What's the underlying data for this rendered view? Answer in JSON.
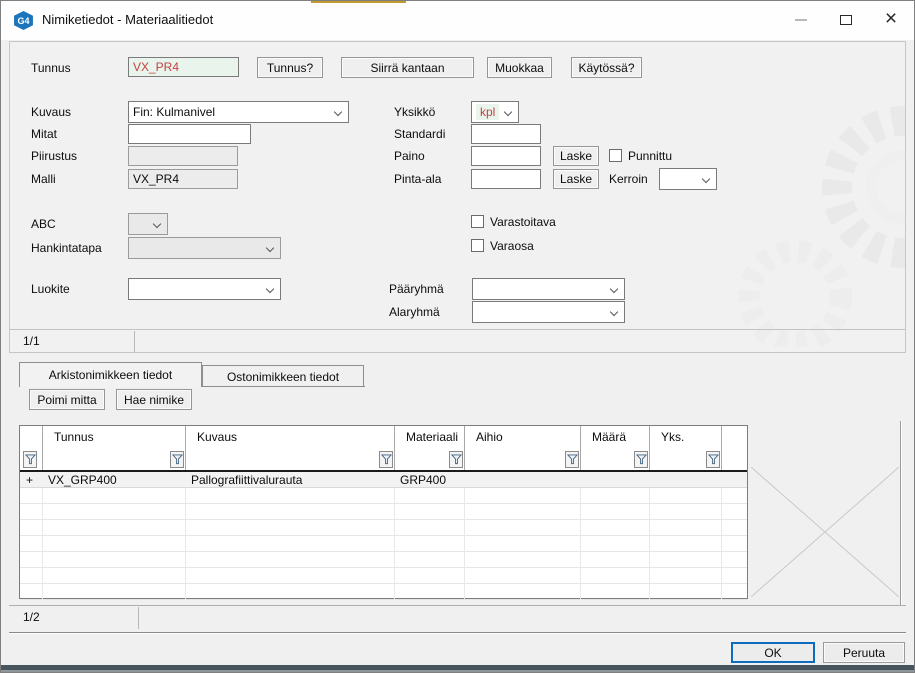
{
  "window": {
    "title": "Nimiketiedot - Materiaalitiedot",
    "icon_text": "G4"
  },
  "top_form": {
    "tunnus_label": "Tunnus",
    "tunnus_value": "VX_PR4",
    "btn_tunnus": "Tunnus?",
    "btn_siirra_kantaan": "Siirrä kantaan",
    "btn_muokkaa": "Muokkaa",
    "btn_kaytossa": "Käytössä?",
    "kuvaus_label": "Kuvaus",
    "kuvaus_value": "Fin: Kulmanivel",
    "yksikko_label": "Yksikkö",
    "yksikko_value": "kpl",
    "mitat_label": "Mitat",
    "mitat_value": "",
    "standardi_label": "Standardi",
    "standardi_value": "",
    "piirustus_label": "Piirustus",
    "piirustus_value": "",
    "paino_label": "Paino",
    "paino_value": "",
    "btn_laske": "Laske",
    "punnittu_label": "Punnittu",
    "malli_label": "Malli",
    "malli_value": "VX_PR4",
    "pinta_ala_label": "Pinta-ala",
    "pinta_ala_value": "",
    "kerroin_label": "Kerroin",
    "abc_label": "ABC",
    "hankintatapa_label": "Hankintatapa",
    "varastoitava_label": "Varastoitava",
    "varaosa_label": "Varaosa",
    "luokite_label": "Luokite",
    "paaryhma_label": "Pääryhmä",
    "alaryhma_label": "Alaryhmä",
    "pager": "1/1"
  },
  "tabs": [
    {
      "label": "Arkistonimikkeen tiedot",
      "active": true
    },
    {
      "label": "Ostonimikkeen tiedot",
      "active": false
    }
  ],
  "archive_tab": {
    "btn_poimi_mitta": "Poimi mitta",
    "btn_hae_nimike": "Hae nimike",
    "pager": "1/2"
  },
  "table": {
    "columns": [
      "Tunnus",
      "Kuvaus",
      "Materiaali",
      "Aihio",
      "Määrä",
      "Yks."
    ],
    "rows": [
      {
        "expand": "+",
        "tunnus": "VX_GRP400",
        "kuvaus": "Pallografiittivalurauta",
        "materiaali": "GRP400",
        "aihio": "",
        "maara": "",
        "yks": ""
      }
    ]
  },
  "footer": {
    "ok": "OK",
    "peruuta": "Peruuta"
  },
  "colors": {
    "field_green": "#e9f5ec",
    "value_red": "#c24242",
    "icon_blue": "#1b75bc",
    "ok_border_blue": "#0e6cbd",
    "gold_accent": "#c19b2e",
    "bottom_strip": "#47555d"
  }
}
